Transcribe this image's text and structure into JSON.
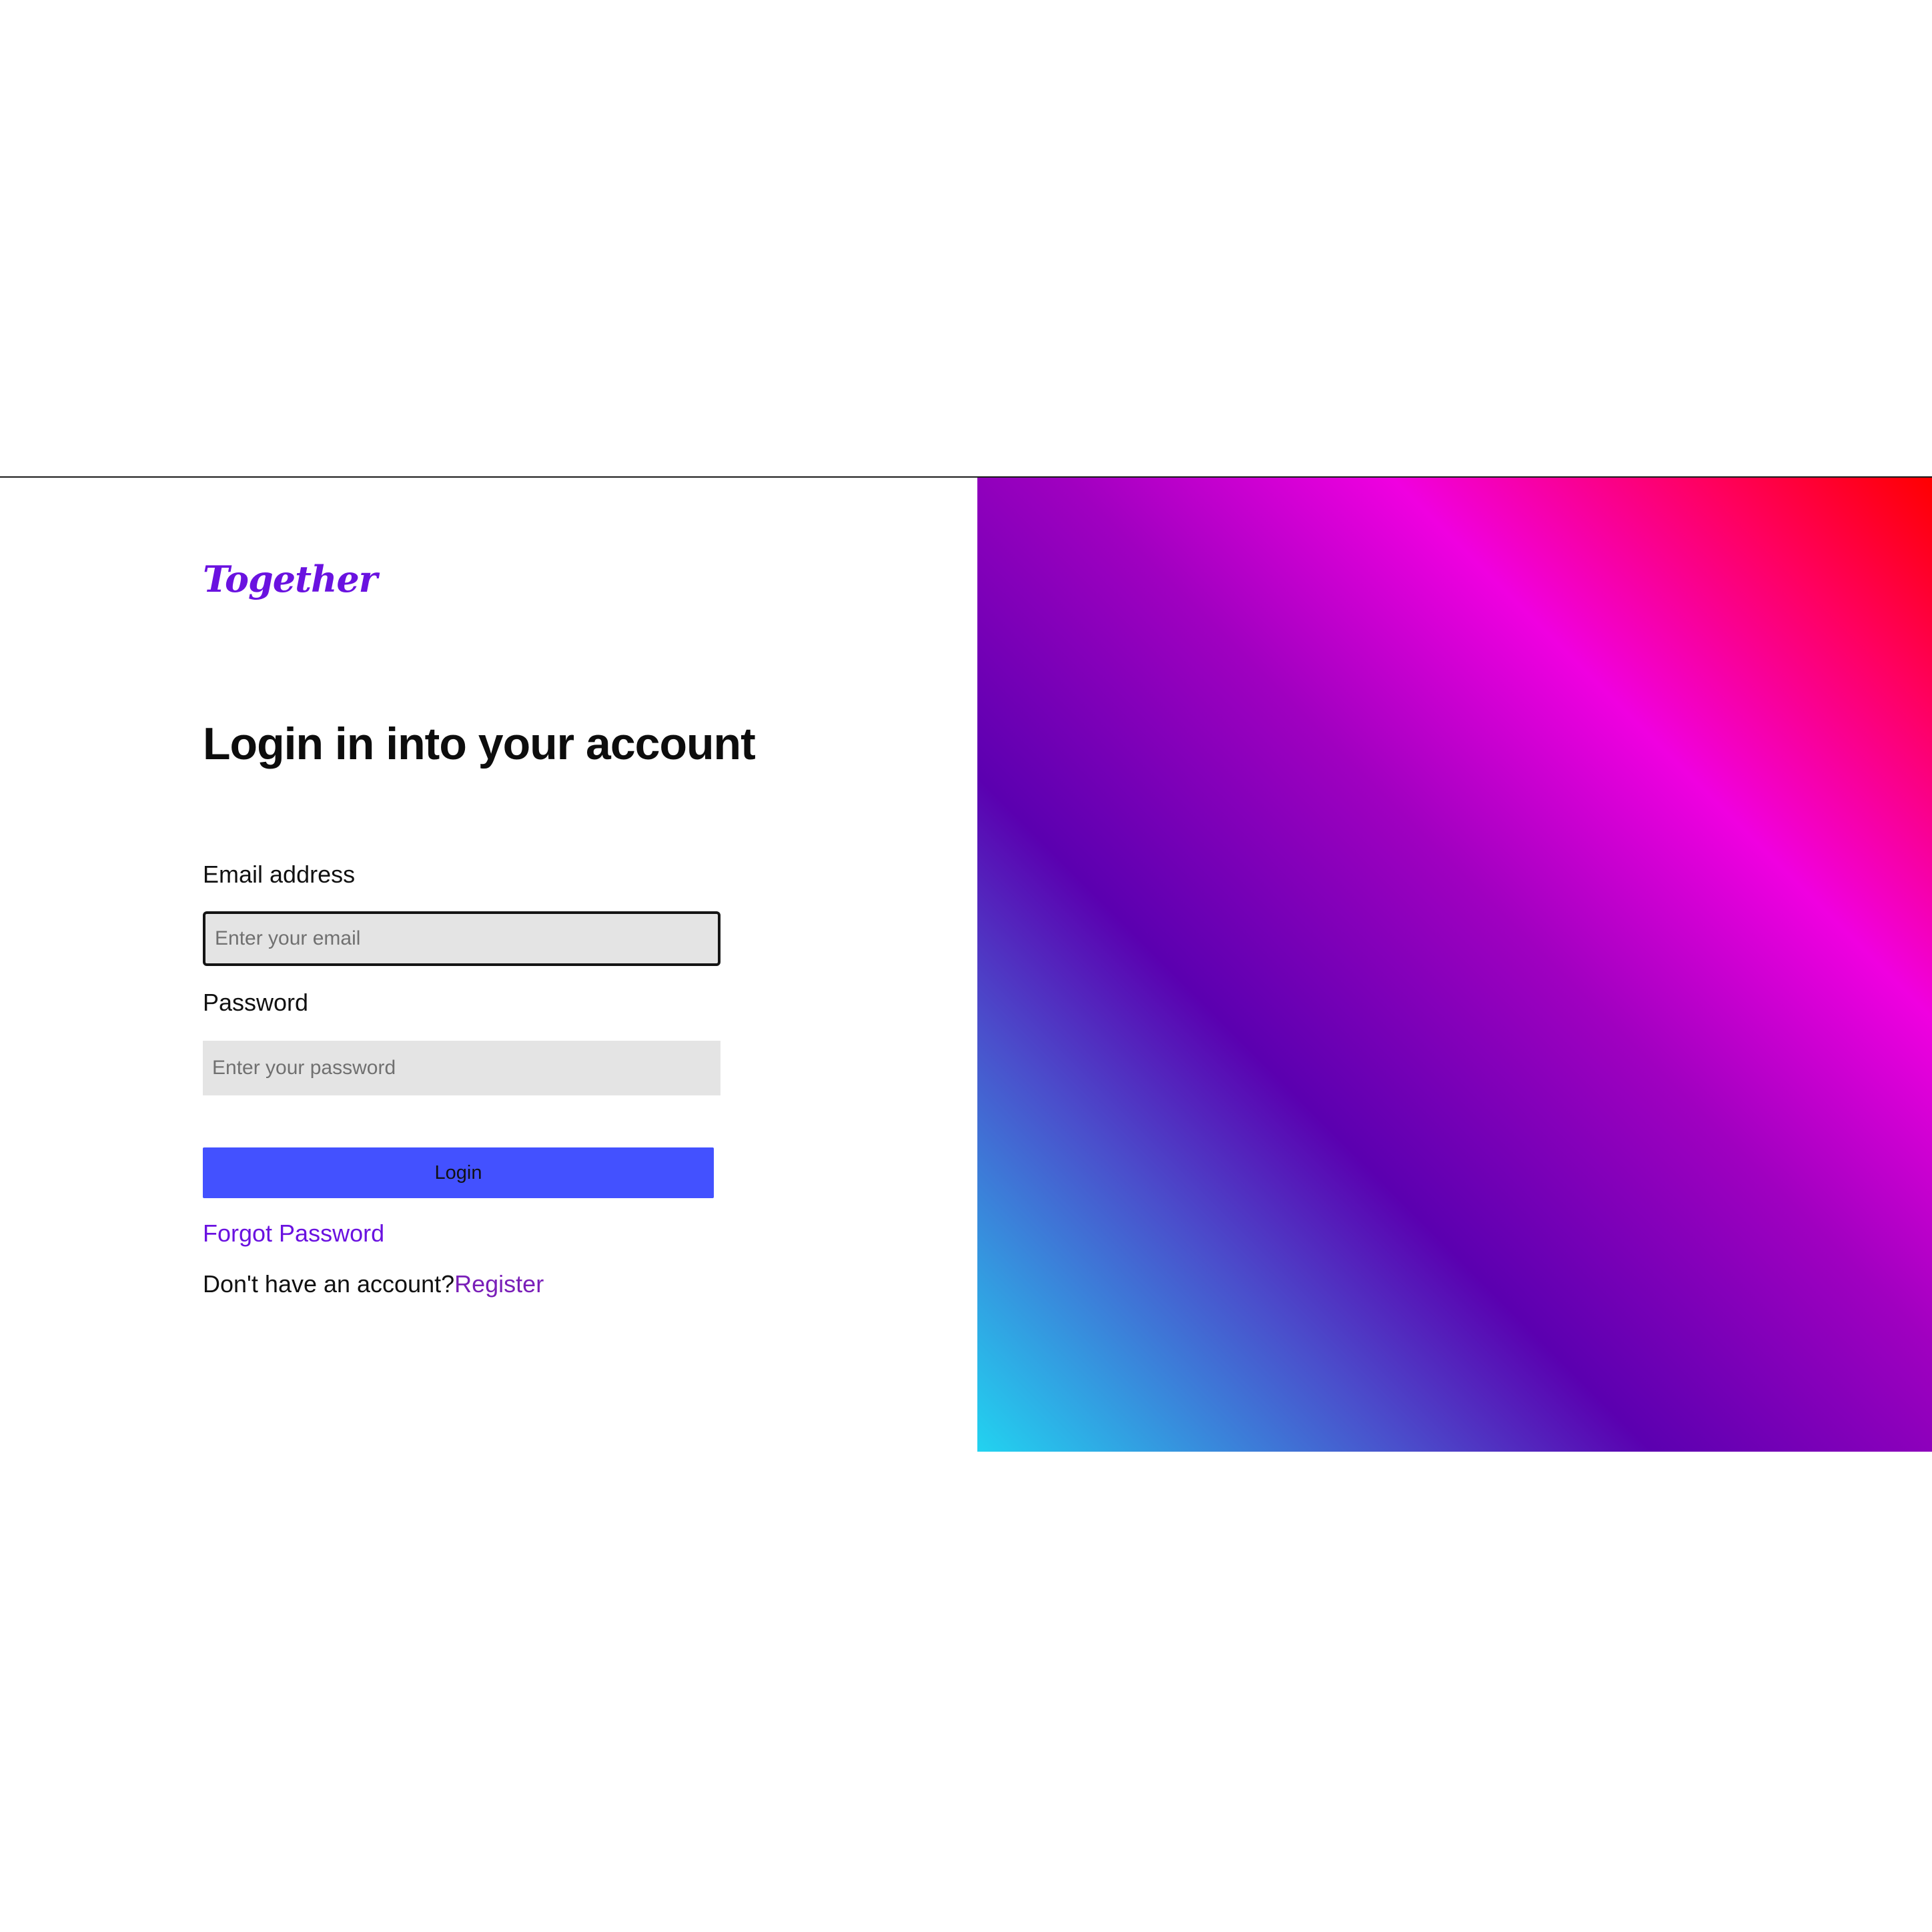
{
  "brand": {
    "logo_text": "Together",
    "accent_color": "#6a12e0"
  },
  "login_form": {
    "title": "Login in into your account",
    "email": {
      "label": "Email address",
      "placeholder": "Enter your email",
      "value": ""
    },
    "password": {
      "label": "Password",
      "placeholder": "Enter your password",
      "value": ""
    },
    "submit_label": "Login",
    "submit_color": "#4351ff",
    "forgot_password_label": "Forgot Password",
    "register_prompt": "Don't have an account?",
    "register_link_label": "Register"
  },
  "hero": {
    "gradient_colors": [
      "#22d3f0",
      "#4a50cc",
      "#5b00b0",
      "#a000c0",
      "#f000e0",
      "#ff0060",
      "#ff0000"
    ]
  }
}
